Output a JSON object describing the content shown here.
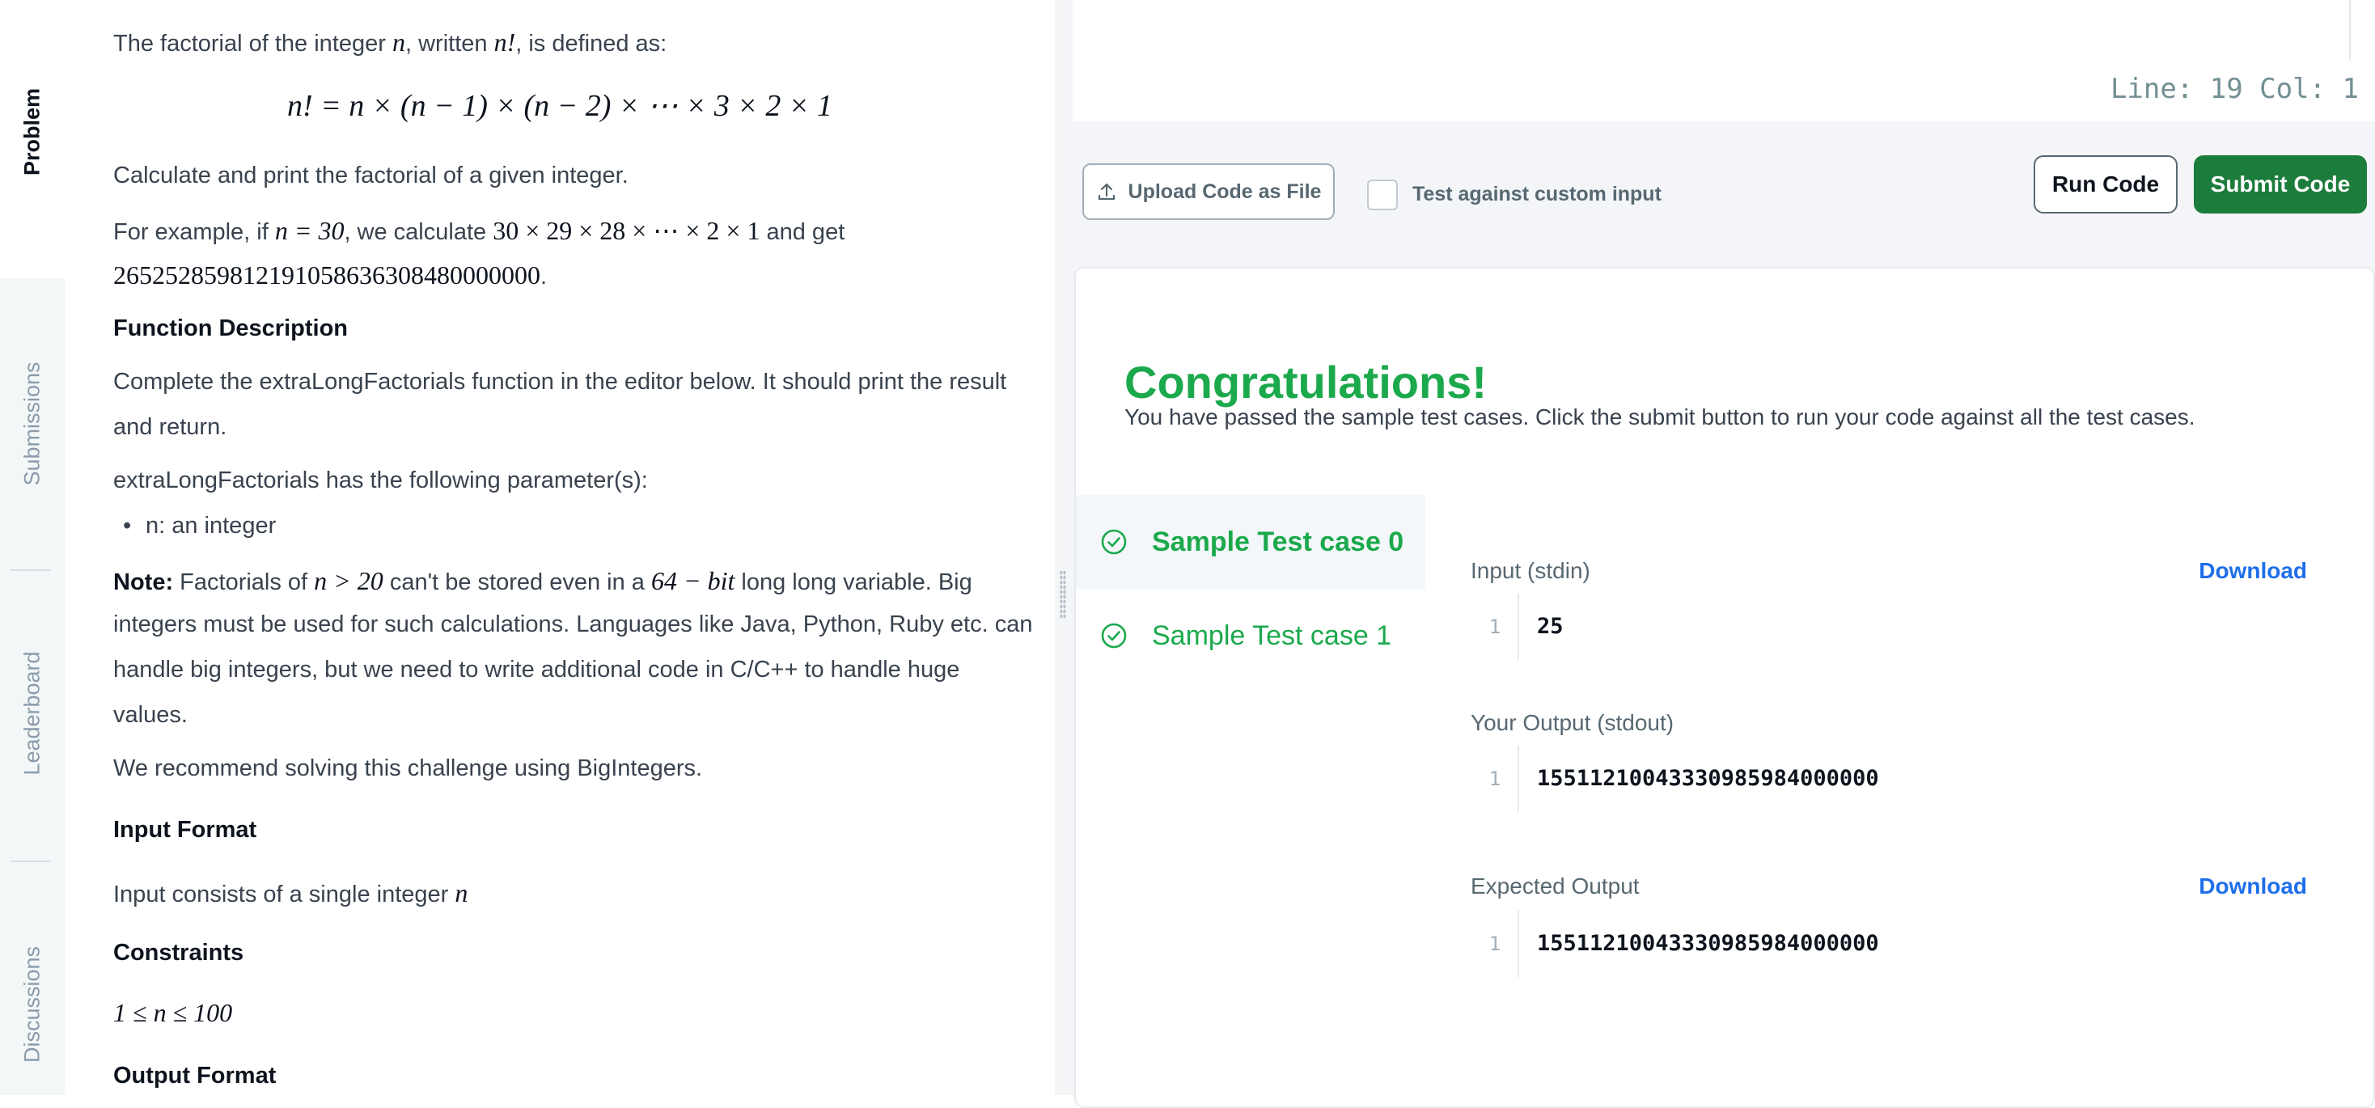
{
  "rail": {
    "tabs": [
      {
        "label": "Problem"
      },
      {
        "label": "Submissions"
      },
      {
        "label": "Leaderboard"
      },
      {
        "label": "Discussions"
      }
    ]
  },
  "problem": {
    "intro_1": "The factorial of the integer ",
    "intro_var": "n",
    "intro_2": ", written ",
    "intro_fact": "n!",
    "intro_3": ", is defined as:",
    "formula": "n! = n × (n − 1) × (n − 2) × ⋯ × 3 × 2 × 1",
    "calc_text": "Calculate and print the factorial of a given integer.",
    "example_1": "For example, if ",
    "example_math_n": "n = 30",
    "example_2": ", we calculate ",
    "example_math_product": "30 × 29 × 28 × ⋯ × 2 × 1",
    "example_3": " and get",
    "example_result": "265252859812191058636308480000000",
    "example_end": ".",
    "function_heading": "Function Description",
    "function_desc_line1": "Complete the extraLongFactorials function in the editor below. It should print the result",
    "function_desc_line2": "and return.",
    "params_intro": "extraLongFactorials has the following parameter(s):",
    "param_n": "n: an integer",
    "note_label": "Note:",
    "note_1": " Factorials of ",
    "note_math_1": "n > 20",
    "note_2": " can't be stored even in a ",
    "note_math_2": "64 − bit",
    "note_3": " long long variable. Big",
    "note_line2": "integers must be used for such calculations. Languages like Java, Python, Ruby etc. can",
    "note_line3": "handle big integers, but we need to write additional code in C/C++ to handle huge",
    "note_line4": "values.",
    "recommend": "We recommend solving this challenge using BigIntegers.",
    "input_heading": "Input Format",
    "input_desc": "Input consists of a single integer ",
    "input_var": "n",
    "constraints_heading": "Constraints",
    "constraint": "1 ≤ n ≤ 100",
    "output_heading": "Output Format"
  },
  "editor": {
    "status": "Line: 19 Col: 1"
  },
  "actions": {
    "upload_label": "Upload Code as File",
    "custom_input_label": "Test against custom input",
    "run_label": "Run Code",
    "submit_label": "Submit Code"
  },
  "results": {
    "title": "Congratulations!",
    "message": "You have passed the sample test cases. Click the submit button to run your code against all the test cases.",
    "cases": [
      {
        "label": "Sample Test case 0",
        "status": "passed"
      },
      {
        "label": "Sample Test case 1",
        "status": "passed"
      }
    ],
    "input_label": "Input (stdin)",
    "input_line": "1",
    "input_value": "25",
    "output_label": "Your Output (stdout)",
    "output_line": "1",
    "output_value": "15511210043330985984000000",
    "expected_label": "Expected Output",
    "expected_line": "1",
    "expected_value": "15511210043330985984000000",
    "download_label": "Download"
  },
  "colors": {
    "success": "#1ba94c",
    "submit_bg": "#1c7c3c",
    "link": "#1f6feb"
  }
}
